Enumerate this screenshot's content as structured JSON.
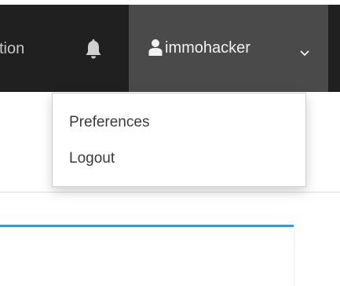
{
  "navbar": {
    "partial_link_label": "tion",
    "notifications_icon": "bell-icon",
    "user": {
      "icon": "user-icon",
      "name": "immohacker",
      "caret_icon": "chevron-down-icon"
    }
  },
  "dropdown": {
    "items": [
      {
        "label": "Preferences"
      },
      {
        "label": "Logout"
      }
    ]
  },
  "colors": {
    "navbar_bg": "#202020",
    "user_menu_bg": "#4a4a4a",
    "accent": "#2d9be0"
  }
}
